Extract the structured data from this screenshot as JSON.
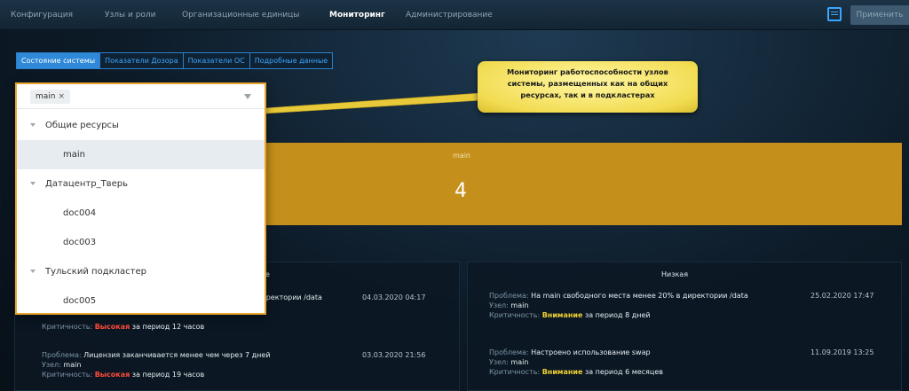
{
  "topnav": {
    "tabs": [
      {
        "label": "Конфигурация"
      },
      {
        "label": "Узлы и роли"
      },
      {
        "label": "Организационные единицы"
      },
      {
        "label": "Мониторинг",
        "active": true
      },
      {
        "label": "Администрирование"
      }
    ],
    "apply_label": "Применить",
    "chat_icon": "message-square-icon"
  },
  "subtabs": [
    {
      "label": "Состояние системы",
      "active": true
    },
    {
      "label": "Показатели Дозора"
    },
    {
      "label": "Показатели ОС"
    },
    {
      "label": "Подробные данные"
    }
  ],
  "callout": {
    "lines": [
      "Мониторинг работоспособности узлов",
      "системы, размещенных как на общих",
      "ресурсах, так и в подкластерах"
    ]
  },
  "dropdown": {
    "chip": "main",
    "chip_remove": "×",
    "groups": [
      {
        "label": "Общие ресурсы",
        "items": [
          {
            "label": "main",
            "selected": true
          }
        ]
      },
      {
        "label": "Датацентр_Тверь",
        "items": [
          {
            "label": "doc004"
          },
          {
            "label": "doc003"
          }
        ]
      },
      {
        "label": "Тульский подкластер",
        "items": [
          {
            "label": "doc005"
          }
        ]
      }
    ]
  },
  "main_card": {
    "label": "main",
    "count": "4",
    "color": "#c48f1a"
  },
  "left_panel": {
    "header_tail": "е",
    "issues": [
      {
        "problem": "директории /data",
        "date": "04.03.2020 04:17",
        "crit_label": "Критичность:",
        "crit_value": "Высокая",
        "period": "за период 12 часов"
      },
      {
        "problem_label": "Проблема:",
        "problem": "Лицензия заканчивается менее чем через 7 дней",
        "date": "03.03.2020 21:56",
        "node_label": "Узел:",
        "node": "main",
        "crit_label": "Критичность:",
        "crit_value": "Высокая",
        "period": "за период 19 часов"
      }
    ]
  },
  "right_panel": {
    "header": "Низкая",
    "issues": [
      {
        "problem_label": "Проблема:",
        "problem": "На main свободного места менее 20% в директории /data",
        "date": "25.02.2020 17:47",
        "node_label": "Узел:",
        "node": "main",
        "crit_label": "Критичность:",
        "crit_value": "Внимание",
        "period": "за период 8 дней"
      },
      {
        "problem_label": "Проблема:",
        "problem": "Настроено использование swap",
        "date": "11.09.2019 13:25",
        "node_label": "Узел:",
        "node": "main",
        "crit_label": "Критичность:",
        "crit_value": "Внимание",
        "period": "за период 6 месяцев"
      }
    ]
  }
}
